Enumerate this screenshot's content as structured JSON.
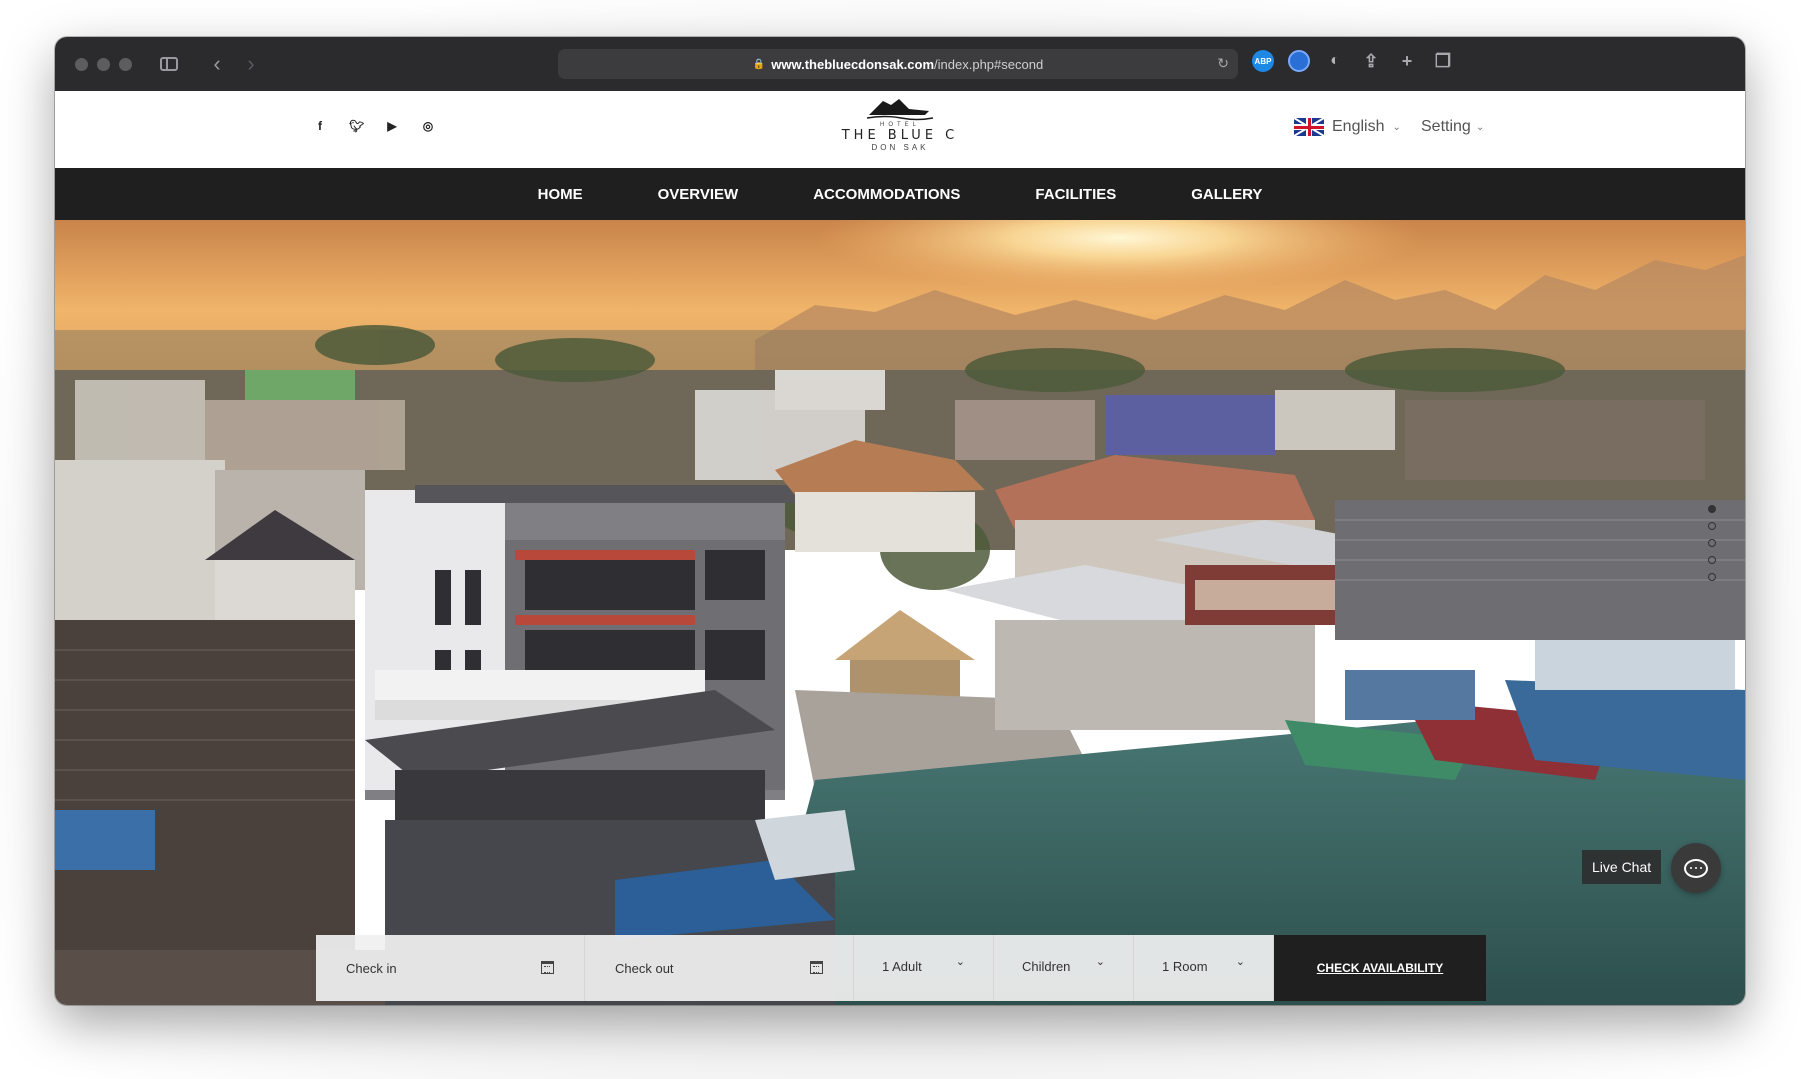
{
  "browser": {
    "url_host": "www.thebluecdonsak.com",
    "url_path": "/index.php#second"
  },
  "header": {
    "social": [
      "facebook-icon",
      "twitter-icon",
      "youtube-icon",
      "instagram-icon"
    ],
    "logo": {
      "top": "HOTEL",
      "name": "THE BLUE C",
      "location": "DON SAK"
    },
    "language": "English",
    "setting": "Setting"
  },
  "nav": {
    "items": [
      "HOME",
      "OVERVIEW",
      "ACCOMMODATIONS",
      "FACILITIES",
      "GALLERY"
    ]
  },
  "hero": {
    "slides": 5,
    "active_slide": 1,
    "live_chat": "Live Chat"
  },
  "booking": {
    "check_in": "Check in",
    "check_out": "Check out",
    "adults": "1 Adult",
    "children": "Children",
    "rooms": "1 Room",
    "submit": "CHECK AVAILABILITY"
  },
  "colors": {
    "chrome": "#2b2b2d",
    "nav": "#1f1f1f",
    "sky": "#e8a24e",
    "water": "#3f6b6a"
  }
}
